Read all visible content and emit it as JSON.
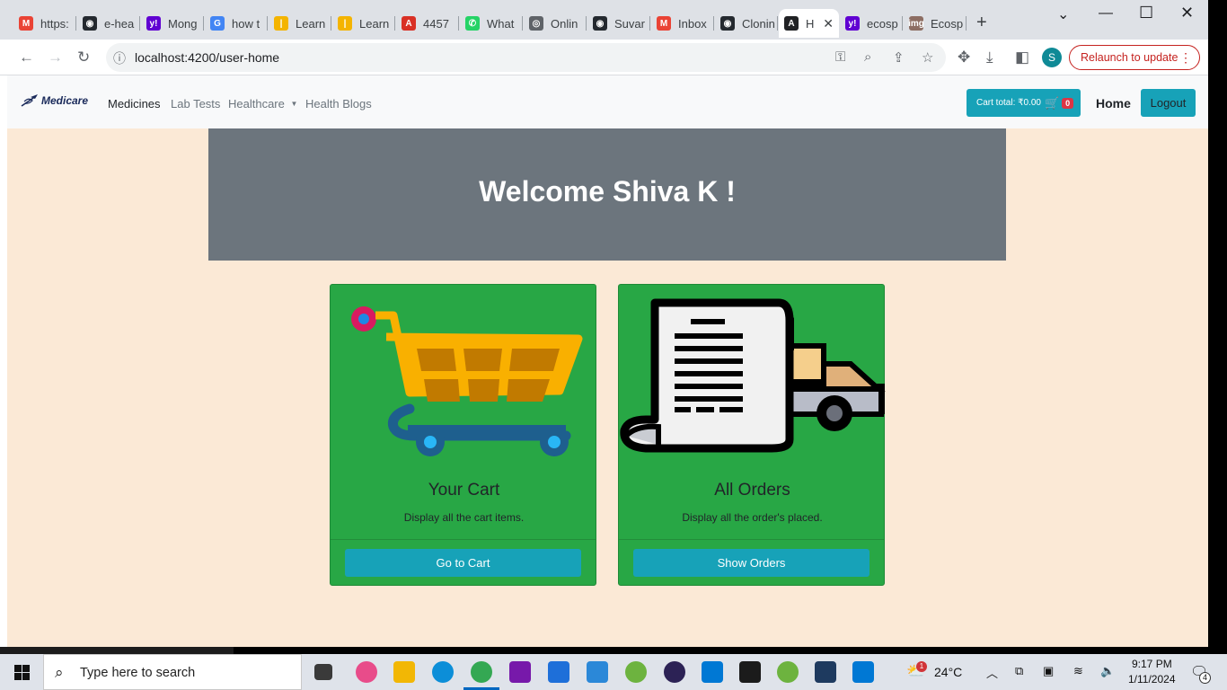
{
  "browser": {
    "tabs": [
      {
        "label": "https:",
        "icon": "gmail-icon",
        "color": "#ea4335",
        "glyph": "M"
      },
      {
        "label": "e-hea",
        "icon": "github-icon",
        "color": "#24292f",
        "glyph": "◉"
      },
      {
        "label": "Mong",
        "icon": "yahoo-icon",
        "color": "#6001d2",
        "glyph": "y!"
      },
      {
        "label": "how t",
        "icon": "google-icon",
        "color": "#4285f4",
        "glyph": "G"
      },
      {
        "label": "Learn",
        "icon": "learn-icon",
        "color": "#f4b400",
        "glyph": "|"
      },
      {
        "label": "Learn",
        "icon": "learn-icon",
        "color": "#f4b400",
        "glyph": "|"
      },
      {
        "label": "4457",
        "icon": "pdf-icon",
        "color": "#d93025",
        "glyph": "A"
      },
      {
        "label": "What",
        "icon": "whatsapp-icon",
        "color": "#25d366",
        "glyph": "✆"
      },
      {
        "label": "Onlin",
        "icon": "globe-icon",
        "color": "#5f6368",
        "glyph": "◎"
      },
      {
        "label": "Suvar",
        "icon": "github-icon",
        "color": "#24292f",
        "glyph": "◉"
      },
      {
        "label": "Inbox",
        "icon": "gmail-icon",
        "color": "#ea4335",
        "glyph": "M"
      },
      {
        "label": "Clonin",
        "icon": "github-icon",
        "color": "#24292f",
        "glyph": "◉"
      },
      {
        "label": "H",
        "icon": "angular-icon",
        "color": "#202124",
        "glyph": "A",
        "active": true
      },
      {
        "label": "ecosp",
        "icon": "yahoo-icon",
        "color": "#6001d2",
        "glyph": "y!"
      },
      {
        "label": "Ecosp",
        "icon": "img-icon",
        "color": "#8d6e63",
        "glyph": "img"
      }
    ],
    "new_tab": "+",
    "url": "localhost:4200/user-home",
    "relaunch_label": "Relaunch to update",
    "profile_initial": "S"
  },
  "navbar": {
    "brand": "Medicare",
    "links": [
      "Medicines",
      "Lab Tests",
      "Healthcare",
      "Health Blogs"
    ],
    "cart_total_label": "Cart total: ₹0.00",
    "cart_count": "0",
    "home": "Home",
    "logout": "Logout"
  },
  "hero": {
    "welcome": "Welcome Shiva K !"
  },
  "cards": [
    {
      "title": "Your Cart",
      "text": "Display all the cart items.",
      "button": "Go to Cart",
      "image": "shopping-cart-icon"
    },
    {
      "title": "All Orders",
      "text": "Display all the order's placed.",
      "button": "Show Orders",
      "image": "delivery-truck-receipt-icon"
    }
  ],
  "taskbar": {
    "search_placeholder": "Type here to search",
    "weather": "24°C",
    "weather_alert": "1",
    "time": "9:17 PM",
    "date": "1/11/2024",
    "notifications": "4"
  },
  "colors": {
    "page_bg": "#fbe9d6",
    "card_green": "#28a745",
    "info_blue": "#17a2b8",
    "jumbotron_grey": "#6c757d",
    "badge_red": "#dc3545"
  }
}
